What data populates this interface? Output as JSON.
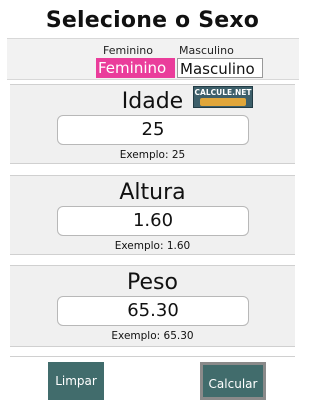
{
  "title": "Selecione o Sexo",
  "sex": {
    "label_fem": "Feminino",
    "label_masc": "Masculino",
    "btn_fem": "Feminino",
    "btn_masc": "Masculino",
    "selected": "Feminino"
  },
  "fields": {
    "age": {
      "label": "Idade",
      "value": "25",
      "hint": "Exemplo: 25"
    },
    "height": {
      "label": "Altura",
      "value": "1.60",
      "hint": "Exemplo: 1.60"
    },
    "weight": {
      "label": "Peso",
      "value": "65.30",
      "hint": "Exemplo: 65.30"
    }
  },
  "logo": {
    "text": "CALCULE.NET"
  },
  "buttons": {
    "clear": "Limpar",
    "calc": "Calcular"
  },
  "colors": {
    "selected_sex": "#ea3d9b",
    "button_bg": "#416c6c"
  }
}
